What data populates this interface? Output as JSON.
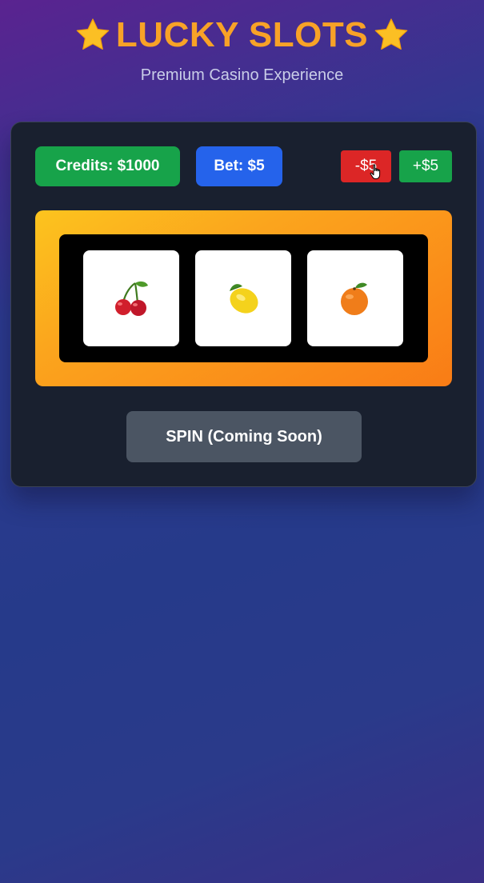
{
  "header": {
    "title": "LUCKY SLOTS",
    "subtitle": "Premium Casino Experience",
    "icon": "star-icon"
  },
  "stats": {
    "credits_label": "Credits: $1000",
    "bet_label": "Bet: $5"
  },
  "bet_controls": {
    "decrease_label": "-$5",
    "increase_label": "+$5"
  },
  "reels": [
    {
      "symbol": "cherry-icon"
    },
    {
      "symbol": "lemon-icon"
    },
    {
      "symbol": "orange-icon"
    }
  ],
  "spin": {
    "label": "SPIN (Coming Soon)"
  },
  "colors": {
    "title": "#f8a227",
    "credits_bg": "#17a34a",
    "bet_bg": "#2563eb",
    "decrease_bg": "#dc2626",
    "increase_bg": "#17a34a",
    "spin_bg": "#4b5563",
    "card_bg": "#19202f"
  }
}
